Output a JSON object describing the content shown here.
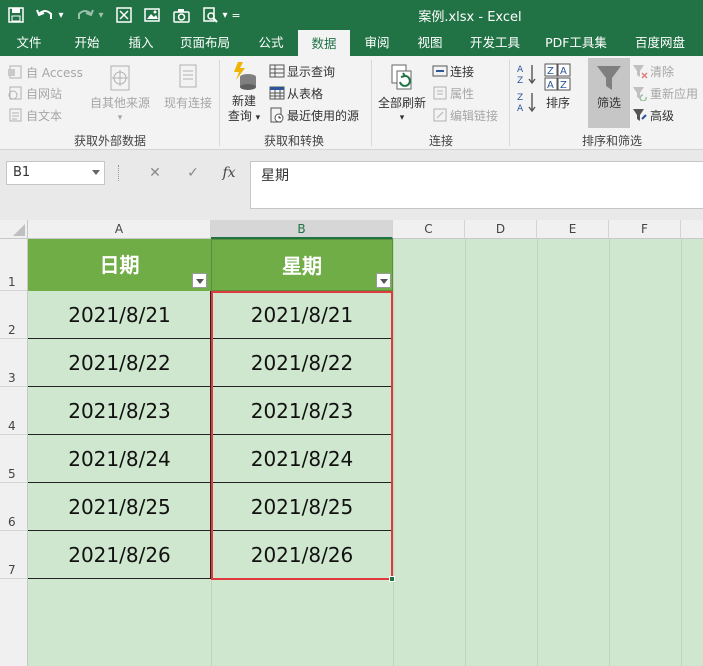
{
  "window": {
    "title": "案例.xlsx - Excel"
  },
  "quick_access": {
    "save": "save-icon",
    "undo": "undo-icon",
    "redo": "redo-icon",
    "chevron": "▾",
    "customize": "="
  },
  "tabs": [
    "文件",
    "开始",
    "插入",
    "页面布局",
    "公式",
    "数据",
    "审阅",
    "视图",
    "开发工具",
    "PDF工具集",
    "百度网盘"
  ],
  "active_tab": "数据",
  "ribbon": {
    "get_external": {
      "label": "获取外部数据",
      "access": "自 Access",
      "web": "自网站",
      "text": "自文本",
      "other_sources": "自其他来源",
      "existing": "现有连接"
    },
    "transform": {
      "label": "获取和转换",
      "new_query_line1": "新建",
      "new_query_line2": "查询",
      "show_queries": "显示查询",
      "from_table": "从表格",
      "recent_sources": "最近使用的源"
    },
    "connections": {
      "label": "连接",
      "refresh_all": "全部刷新",
      "connections": "连接",
      "properties": "属性",
      "edit_links": "编辑链接"
    },
    "sort_filter": {
      "label": "排序和筛选",
      "sort": "排序",
      "filter": "筛选",
      "clear": "清除",
      "reapply": "重新应用",
      "advanced": "高级"
    }
  },
  "formula_bar": {
    "name_box": "B1",
    "cancel": "✕",
    "enter": "✓",
    "fx": "fx",
    "content": "星期"
  },
  "sheet": {
    "columns": [
      "A",
      "B",
      "C",
      "D",
      "E",
      "F"
    ],
    "rows": [
      "1",
      "2",
      "3",
      "4",
      "5",
      "6",
      "7"
    ],
    "headers": [
      "日期",
      "星期"
    ],
    "data": [
      [
        "2021/8/21",
        "2021/8/21"
      ],
      [
        "2021/8/22",
        "2021/8/22"
      ],
      [
        "2021/8/23",
        "2021/8/23"
      ],
      [
        "2021/8/24",
        "2021/8/24"
      ],
      [
        "2021/8/25",
        "2021/8/25"
      ],
      [
        "2021/8/26",
        "2021/8/26"
      ]
    ],
    "selected_cell": "B1"
  },
  "colors": {
    "brand": "#217346",
    "header_fill": "#70ad47",
    "sheet_bg": "#cfe7ce",
    "selection_border": "#e03a3e"
  }
}
